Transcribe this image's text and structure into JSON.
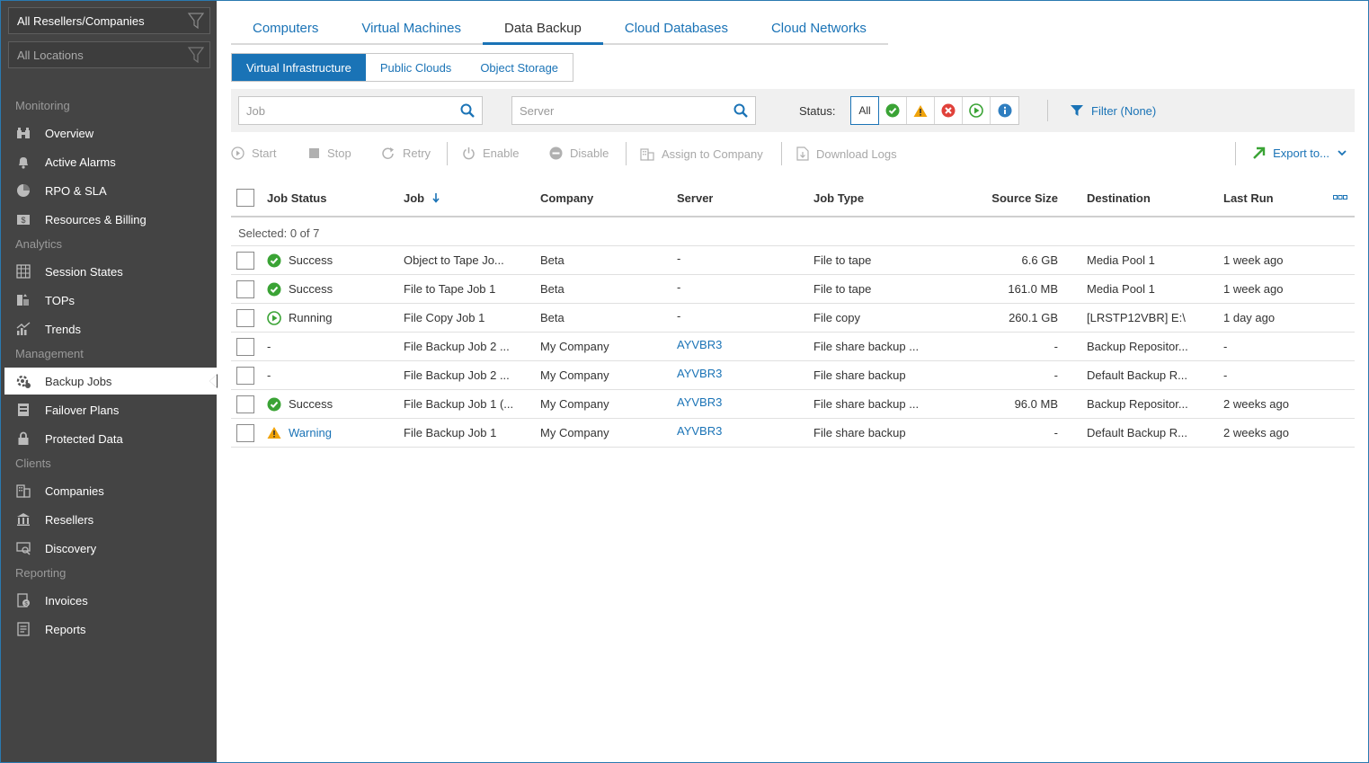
{
  "sidebar": {
    "reseller_filter": "All Resellers/Companies",
    "location_filter": "All Locations",
    "groups": [
      {
        "label": "Monitoring",
        "items": [
          {
            "label": "Overview",
            "icon": "binoculars-icon"
          },
          {
            "label": "Active Alarms",
            "icon": "bell-icon"
          },
          {
            "label": "RPO & SLA",
            "icon": "pie-chart-icon"
          },
          {
            "label": "Resources & Billing",
            "icon": "billing-icon"
          }
        ]
      },
      {
        "label": "Analytics",
        "items": [
          {
            "label": "Session States",
            "icon": "grid-calendar-icon"
          },
          {
            "label": "TOPs",
            "icon": "tops-icon"
          },
          {
            "label": "Trends",
            "icon": "trends-icon"
          }
        ]
      },
      {
        "label": "Management",
        "items": [
          {
            "label": "Backup Jobs",
            "icon": "backup-jobs-icon",
            "active": true
          },
          {
            "label": "Failover Plans",
            "icon": "failover-icon"
          },
          {
            "label": "Protected Data",
            "icon": "lock-icon"
          }
        ]
      },
      {
        "label": "Clients",
        "items": [
          {
            "label": "Companies",
            "icon": "building-icon"
          },
          {
            "label": "Resellers",
            "icon": "bank-icon"
          },
          {
            "label": "Discovery",
            "icon": "discovery-icon"
          }
        ]
      },
      {
        "label": "Reporting",
        "items": [
          {
            "label": "Invoices",
            "icon": "invoice-icon"
          },
          {
            "label": "Reports",
            "icon": "report-icon"
          }
        ]
      }
    ]
  },
  "tabs": [
    "Computers",
    "Virtual Machines",
    "Data Backup",
    "Cloud Databases",
    "Cloud Networks"
  ],
  "active_tab": "Data Backup",
  "subtabs": [
    "Virtual Infrastructure",
    "Public Clouds",
    "Object Storage"
  ],
  "active_subtab": "Virtual Infrastructure",
  "filters": {
    "job_placeholder": "Job",
    "server_placeholder": "Server",
    "status_label": "Status:",
    "status_all": "All",
    "filter_link": "Filter (None)"
  },
  "toolbar": {
    "start": "Start",
    "stop": "Stop",
    "retry": "Retry",
    "enable": "Enable",
    "disable": "Disable",
    "assign": "Assign to Company",
    "download_logs": "Download Logs",
    "export": "Export to..."
  },
  "table": {
    "columns": {
      "job_status": "Job Status",
      "job": "Job",
      "company": "Company",
      "server": "Server",
      "job_type": "Job Type",
      "source_size": "Source Size",
      "destination": "Destination",
      "last_run": "Last Run"
    },
    "selected_text": "Selected: 0 of 7",
    "rows": [
      {
        "status": "Success",
        "status_kind": "success",
        "job": "Object to Tape Jo...",
        "company": "Beta",
        "server": "-",
        "server_link": false,
        "job_type": "File to tape",
        "source_size": "6.6 GB",
        "destination": "Media Pool 1",
        "last_run": "1 week ago"
      },
      {
        "status": "Success",
        "status_kind": "success",
        "job": "File to Tape Job 1",
        "company": "Beta",
        "server": "-",
        "server_link": false,
        "job_type": "File to tape",
        "source_size": "161.0 MB",
        "destination": "Media Pool 1",
        "last_run": "1 week ago"
      },
      {
        "status": "Running",
        "status_kind": "running",
        "job": "File Copy Job 1",
        "company": "Beta",
        "server": "-",
        "server_link": false,
        "job_type": "File copy",
        "source_size": "260.1 GB",
        "destination": "[LRSTP12VBR] E:\\",
        "last_run": "1 day ago"
      },
      {
        "status": "-",
        "status_kind": "none",
        "job": "File Backup Job 2 ...",
        "company": "My Company",
        "server": "AYVBR3",
        "server_link": true,
        "job_type": "File share backup ...",
        "source_size": "-",
        "destination": "Backup Repositor...",
        "last_run": "-"
      },
      {
        "status": "-",
        "status_kind": "none",
        "job": "File Backup Job 2 ...",
        "company": "My Company",
        "server": "AYVBR3",
        "server_link": true,
        "job_type": "File share backup",
        "source_size": "-",
        "destination": "Default Backup R...",
        "last_run": "-"
      },
      {
        "status": "Success",
        "status_kind": "success",
        "job": "File Backup Job 1 (...",
        "company": "My Company",
        "server": "AYVBR3",
        "server_link": true,
        "job_type": "File share backup ...",
        "source_size": "96.0 MB",
        "destination": "Backup Repositor...",
        "last_run": "2 weeks ago"
      },
      {
        "status": "Warning",
        "status_kind": "warning",
        "job": "File Backup Job 1",
        "company": "My Company",
        "server": "AYVBR3",
        "server_link": true,
        "job_type": "File share backup",
        "source_size": "-",
        "destination": "Default Backup R...",
        "last_run": "2 weeks ago"
      }
    ]
  },
  "colors": {
    "accent": "#1a73b6",
    "success": "#3aa335",
    "warning": "#f0a30a",
    "error": "#e0413a",
    "sidebar_bg": "#444444"
  }
}
